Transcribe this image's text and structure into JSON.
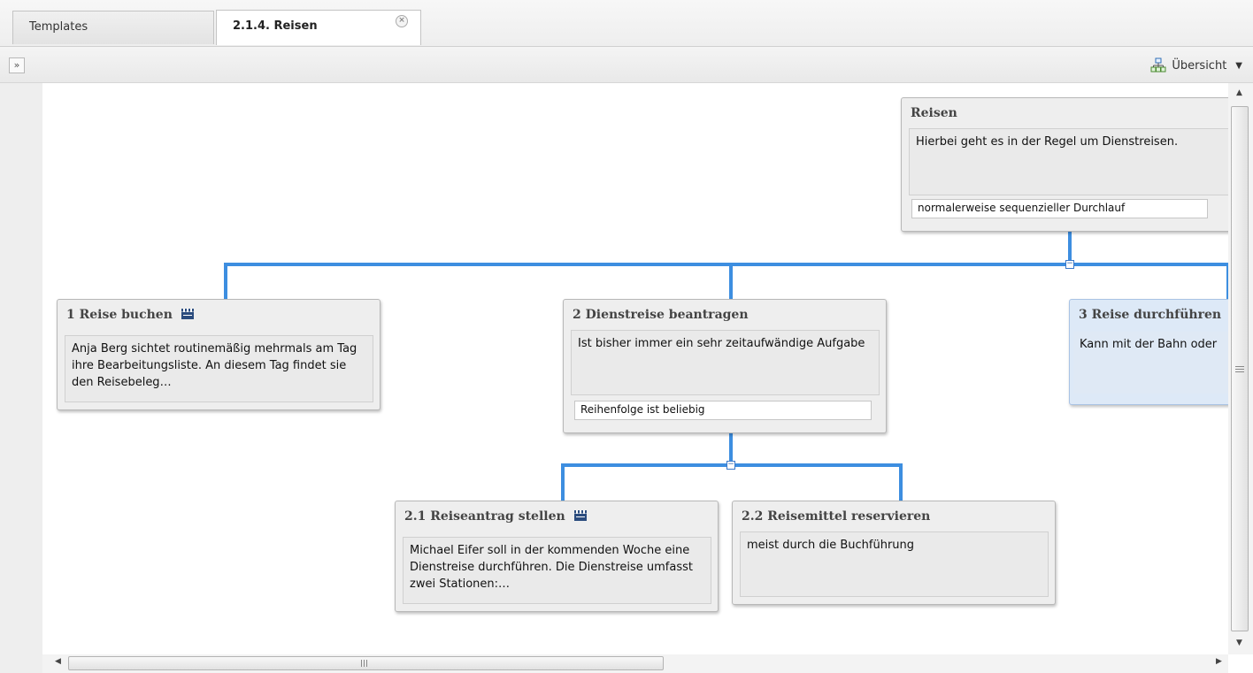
{
  "tabs": [
    {
      "label": "Templates",
      "active": false
    },
    {
      "label": "2.1.4. Reisen",
      "active": true
    }
  ],
  "toolbar": {
    "expand_glyph": "»",
    "overview_label": "Übersicht",
    "overview_icon": "hierarchy-icon"
  },
  "nodes": {
    "root": {
      "title": "Reisen",
      "description": "Hierbei geht es in der Regel um Dienstreisen.",
      "rule": "normalerweise sequenzieller Durchlauf"
    },
    "n1": {
      "title": "1 Reise buchen",
      "description": "Anja Berg sichtet routinemäßig mehrmals am Tag ihre Bearbeitungsliste. An diesem Tag findet sie den Reisebeleg…",
      "icon": "clapperboard-icon"
    },
    "n2": {
      "title": "2 Dienstreise beantragen",
      "description": "Ist bisher immer ein sehr zeitaufwändige Aufgabe",
      "rule": "Reihenfolge ist beliebig"
    },
    "n3": {
      "title": "3 Reise durchführen",
      "description": "Kann mit der Bahn oder"
    },
    "n21": {
      "title": "2.1 Reiseantrag stellen",
      "description": "Michael Eifer soll in der kommenden Woche eine Dienstreise durchführen. Die Dienstreise umfasst zwei Stationen:…",
      "icon": "clapperboard-icon"
    },
    "n22": {
      "title": "2.2 Reisemittel reservieren",
      "description": "meist durch die Buchführung"
    }
  },
  "colors": {
    "connector": "#3d8ee0",
    "card_bg": "#eeeeee",
    "selected_card_bg": "#dde9f7"
  }
}
